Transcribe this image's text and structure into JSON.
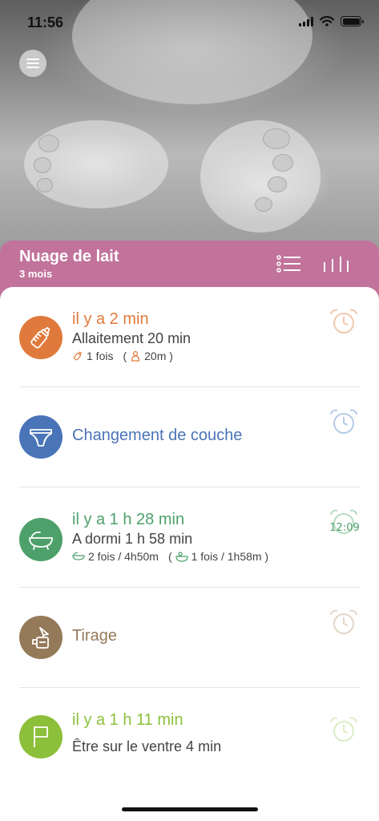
{
  "status_bar": {
    "time": "11:56"
  },
  "colors": {
    "header": "#c1739b",
    "feeding": "#e07a3c",
    "diaper": "#4a74b8",
    "sleep": "#4ea06a",
    "pump": "#957a5a",
    "tummy": "#8cbf3a"
  },
  "header": {
    "name": "Nuage de lait",
    "age": "3 mois"
  },
  "activities": [
    {
      "icon": "bottle-icon",
      "title": "il y a 2 min",
      "description": "Allaitement 20 min",
      "meta_1": "1 fois",
      "meta_open": "(",
      "meta_2": "20m )"
    },
    {
      "icon": "diaper-icon",
      "title": "Changement de couche"
    },
    {
      "icon": "crib-icon",
      "title": "il y a 1 h 28 min",
      "description": "A dormi 1 h 58 min",
      "meta_1": "2 fois / 4h50m",
      "meta_open": "(",
      "meta_2": "1 fois / 1h58m )",
      "alarm_time": "12:09"
    },
    {
      "icon": "breast-pump-icon",
      "title": "Tirage"
    },
    {
      "icon": "flag-icon",
      "title": "il y a 1 h 11 min",
      "description": "Être sur le ventre  4 min"
    }
  ]
}
